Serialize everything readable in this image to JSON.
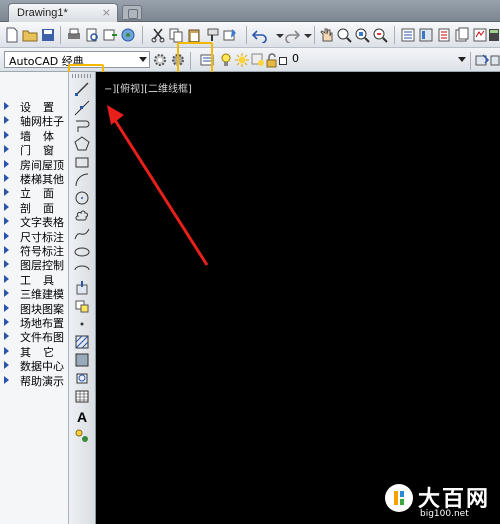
{
  "tab": {
    "title": "Drawing1*",
    "close": "×"
  },
  "workspace": {
    "value": "AutoCAD 经典"
  },
  "layer": {
    "value": "0"
  },
  "viewport": {
    "label": "−][俯视][二维线框]"
  },
  "palette": {
    "items": [
      {
        "label": "设置",
        "wide": true
      },
      {
        "label": "轴网柱子",
        "wide": false
      },
      {
        "label": "墙体",
        "wide": true
      },
      {
        "label": "门窗",
        "wide": true
      },
      {
        "label": "房间屋顶",
        "wide": false
      },
      {
        "label": "楼梯其他",
        "wide": false
      },
      {
        "label": "立面",
        "wide": true
      },
      {
        "label": "剖面",
        "wide": true
      },
      {
        "label": "文字表格",
        "wide": false
      },
      {
        "label": "尺寸标注",
        "wide": false
      },
      {
        "label": "符号标注",
        "wide": false
      },
      {
        "label": "图层控制",
        "wide": false
      },
      {
        "label": "工具",
        "wide": true
      },
      {
        "label": "三维建模",
        "wide": false
      },
      {
        "label": "图块图案",
        "wide": false
      },
      {
        "label": "场地布置",
        "wide": false
      },
      {
        "label": "文件布图",
        "wide": false
      },
      {
        "label": "其它",
        "wide": true
      },
      {
        "label": "数据中心",
        "wide": false
      },
      {
        "label": "帮助演示",
        "wide": false
      }
    ]
  },
  "drawbar": {
    "text_tool": "A"
  },
  "watermark": {
    "text": "大百网",
    "url": "big100.net"
  },
  "colors": {
    "highlight": "#f5b800",
    "arrow": "#e8201c",
    "canvas": "#000000"
  }
}
